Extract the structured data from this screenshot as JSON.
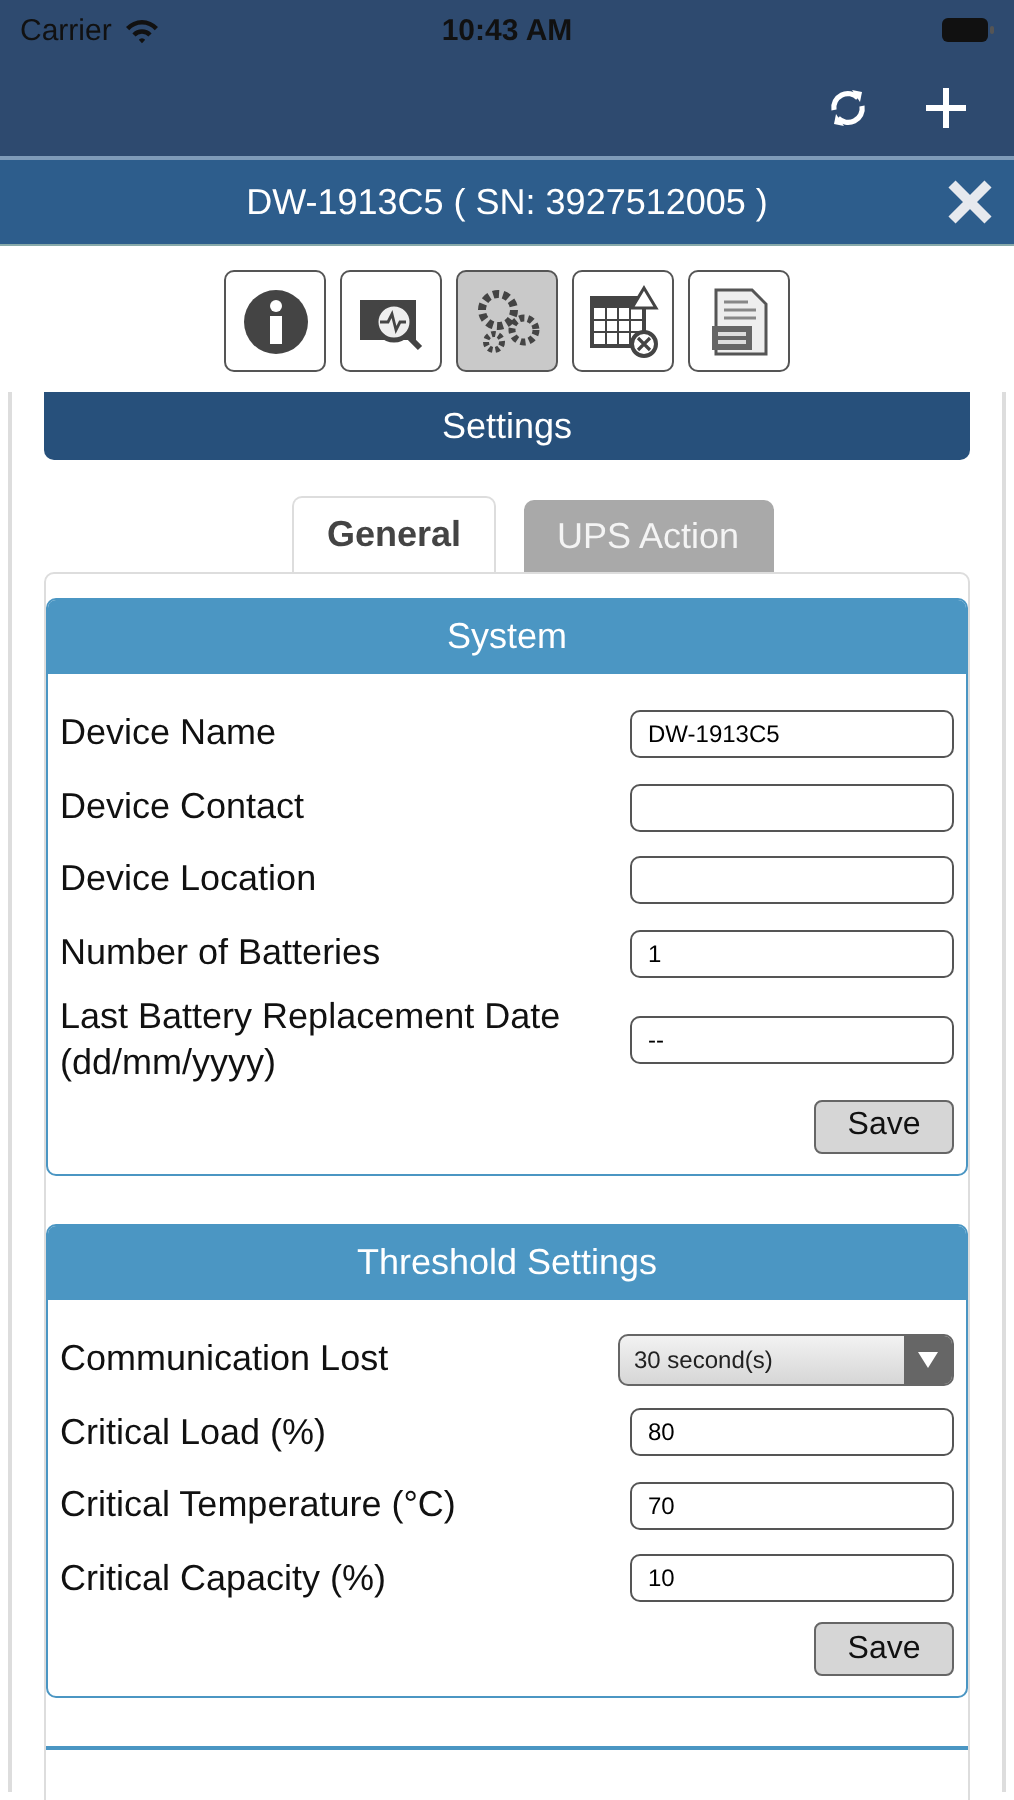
{
  "status_bar": {
    "carrier": "Carrier",
    "time": "10:43 AM"
  },
  "dialog": {
    "title": "DW-1913C5 ( SN: 3927512005 )"
  },
  "toolbar": [
    {
      "kind": "info",
      "selected": false
    },
    {
      "kind": "monitor",
      "selected": false
    },
    {
      "kind": "settings",
      "selected": true
    },
    {
      "kind": "schedule",
      "selected": false
    },
    {
      "kind": "datalog",
      "selected": false
    }
  ],
  "page_title": "Settings",
  "tabs": [
    {
      "label": "General",
      "selected": true
    },
    {
      "label": "UPS Action",
      "selected": false
    }
  ],
  "sections": [
    {
      "title": "System",
      "fields": [
        {
          "kind": "text",
          "label": "Device Name",
          "value": "DW-1913C5"
        },
        {
          "kind": "text",
          "label": "Device Contact"
        },
        {
          "kind": "text",
          "label": "Device Location"
        },
        {
          "kind": "text",
          "label": "Number of Batteries",
          "value": "1"
        },
        {
          "kind": "text",
          "label": "Last Battery Replacement Date (dd/mm/yyyy)",
          "value": "--"
        }
      ],
      "button": "Save"
    },
    {
      "title": "Threshold Settings",
      "fields": [
        {
          "kind": "select",
          "label": "Communication Lost",
          "value": "30 second(s)"
        },
        {
          "kind": "text",
          "label": "Critical Load (%)",
          "value": "80"
        },
        {
          "kind": "text",
          "label": "Critical Temperature (°C)",
          "value": "70"
        },
        {
          "kind": "text",
          "label": "Critical Capacity (%)",
          "value": "10"
        }
      ],
      "button": "Save"
    }
  ]
}
